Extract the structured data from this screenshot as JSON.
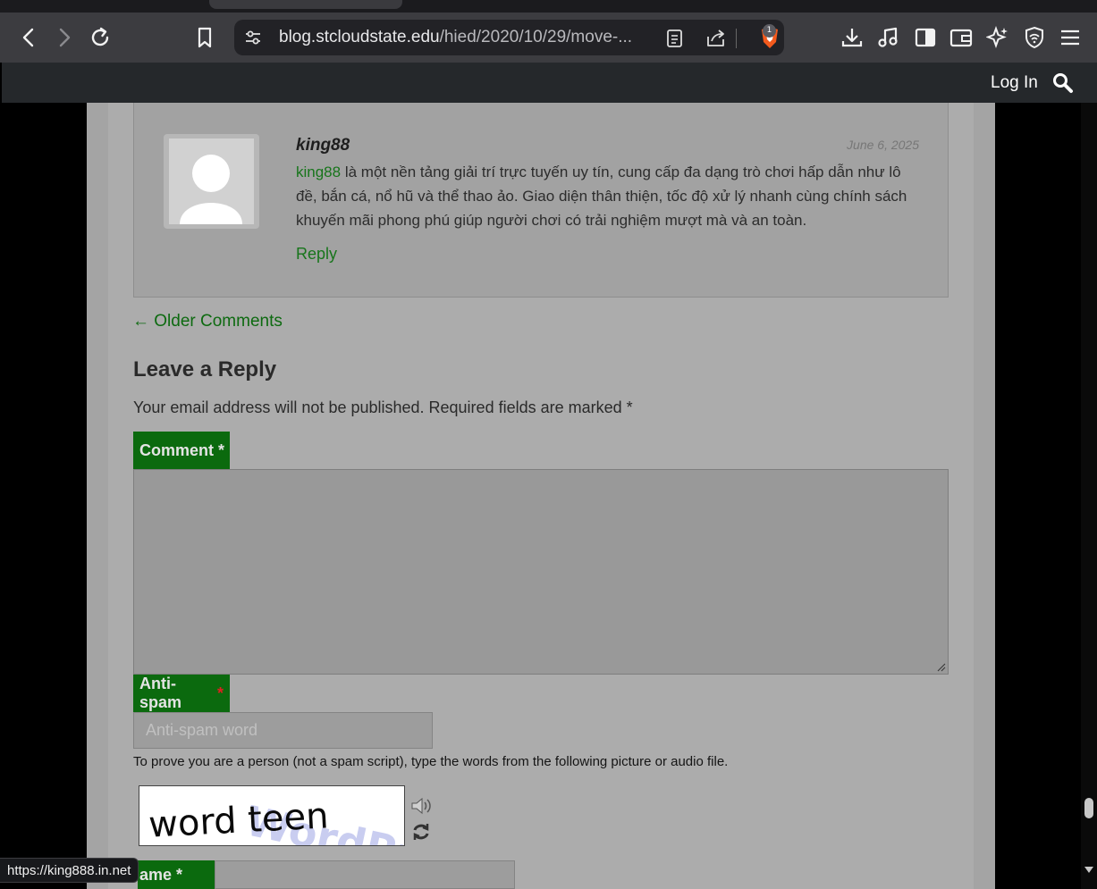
{
  "browser": {
    "url_host": "blog.stcloudstate.edu",
    "url_path": "/hied/2020/10/29/move-...",
    "shields_count": "1",
    "status_url": "https://king888.in.net"
  },
  "site": {
    "login_label": "Log In"
  },
  "comment": {
    "author": "king88",
    "date": "June 6, 2025",
    "link_word": "king88",
    "text": " là một nền tảng giải trí trực tuyến uy tín, cung cấp đa dạng trò chơi hấp dẫn như lô đề, bắn cá, nổ hũ và thể thao ảo. Giao diện thân thiện, tốc độ xử lý nhanh cùng chính sách khuyến mãi phong phú giúp người chơi có trải nghiệm mượt mà và an toàn.",
    "reply_label": "Reply"
  },
  "older_comments": "← Older Comments",
  "form": {
    "title": "Leave a Reply",
    "notes": "Your email address will not be published. Required fields are marked *",
    "comment_label": "Comment",
    "required_mark": "*",
    "antispam_label": "Anti-spam",
    "antispam_placeholder": "Anti-spam word",
    "antispam_help": "To prove you are a person (not a spam script), type the words from the following picture or audio file.",
    "captcha_words": "word teen",
    "name_label": "ame"
  },
  "colors": {
    "link_green": "#17751b",
    "label_green": "#0b6a0e",
    "required_red": "#e02020"
  }
}
